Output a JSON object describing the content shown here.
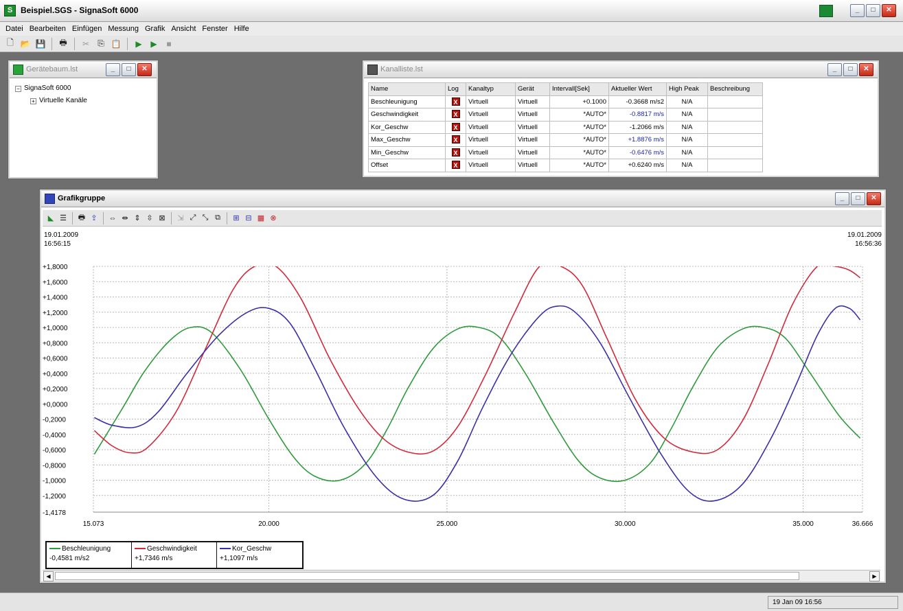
{
  "app": {
    "title": "Beispiel.SGS - SignaSoft 6000"
  },
  "menu": [
    "Datei",
    "Bearbeiten",
    "Einfügen",
    "Messung",
    "Grafik",
    "Ansicht",
    "Fenster",
    "Hilfe"
  ],
  "toolbar": {
    "icons": [
      "new-file-icon",
      "open-folder-icon",
      "save-icon",
      "print-icon",
      "cut-icon",
      "copy-icon",
      "paste-icon",
      "start-icon",
      "start-all-icon",
      "stop-icon"
    ]
  },
  "tree_window": {
    "title": "Gerätebaum.lst",
    "items": [
      {
        "label": "SignaSoft 6000",
        "pm": "−"
      },
      {
        "label": "Virtuelle Kanäle",
        "pm": "+"
      }
    ]
  },
  "channel_window": {
    "title": "Kanalliste.lst",
    "columns": [
      "Name",
      "Log",
      "Kanaltyp",
      "Gerät",
      "Intervall[Sek]",
      "Aktueller Wert",
      "High Peak",
      "Beschreibung"
    ],
    "rows": [
      {
        "name": "Beschleunigung",
        "log": "X",
        "typ": "Virtuell",
        "geraet": "Virtuell",
        "intervall": "+0.1000",
        "wert": "-0.3668 m/s2",
        "high": "N/A",
        "beschr": "",
        "blue": false
      },
      {
        "name": "Geschwindigkeit",
        "log": "X",
        "typ": "Virtuell",
        "geraet": "Virtuell",
        "intervall": "*AUTO*",
        "wert": "-0.8817 m/s",
        "high": "N/A",
        "beschr": "",
        "blue": true
      },
      {
        "name": "Kor_Geschw",
        "log": "X",
        "typ": "Virtuell",
        "geraet": "Virtuell",
        "intervall": "*AUTO*",
        "wert": "-1.2066 m/s",
        "high": "N/A",
        "beschr": "",
        "blue": false
      },
      {
        "name": "Max_Geschw",
        "log": "X",
        "typ": "Virtuell",
        "geraet": "Virtuell",
        "intervall": "*AUTO*",
        "wert": "+1.8876 m/s",
        "high": "N/A",
        "beschr": "",
        "blue": true
      },
      {
        "name": "Min_Geschw",
        "log": "X",
        "typ": "Virtuell",
        "geraet": "Virtuell",
        "intervall": "*AUTO*",
        "wert": "-0.6476 m/s",
        "high": "N/A",
        "beschr": "",
        "blue": true
      },
      {
        "name": "Offset",
        "log": "X",
        "typ": "Virtuell",
        "geraet": "Virtuell",
        "intervall": "*AUTO*",
        "wert": "+0.6240 m/s",
        "high": "N/A",
        "beschr": "",
        "blue": false
      }
    ]
  },
  "graph_window": {
    "title": "Grafikgruppe",
    "start_date": "19.01.2009",
    "start_time": "16:56:15",
    "end_date": "19.01.2009",
    "end_time": "16:56:36",
    "legend": [
      {
        "name": "Beschleunigung",
        "value": "-0,4581 m/s2",
        "color": "#2e9a3c"
      },
      {
        "name": "Geschwindigkeit",
        "value": "+1,7346 m/s",
        "color": "#d4283a"
      },
      {
        "name": "Kor_Geschw",
        "value": "+1,1097 m/s",
        "color": "#3a2fa8"
      }
    ]
  },
  "chart_data": {
    "type": "line",
    "ylim": [
      -1.4178,
      1.8
    ],
    "xlim": [
      15.073,
      36.666
    ],
    "y_ticks": [
      "+1,8000",
      "+1,6000",
      "+1,4000",
      "+1,2000",
      "+1,0000",
      "+0,8000",
      "+0,6000",
      "+0,4000",
      "+0,2000",
      "+0,0000",
      "-0,2000",
      "-0,4000",
      "-0,6000",
      "-0,8000",
      "-1,0000",
      "-1,2000",
      "-1,4178"
    ],
    "y_tick_values": [
      1.8,
      1.6,
      1.4,
      1.2,
      1.0,
      0.8,
      0.6,
      0.4,
      0.2,
      0.0,
      -0.2,
      -0.4,
      -0.6,
      -0.8,
      -1.0,
      -1.2,
      -1.4178
    ],
    "x_ticks": [
      "15.073",
      "20.000",
      "25.000",
      "30.000",
      "35.000",
      "36.666"
    ],
    "x_tick_values": [
      15.073,
      20.0,
      25.0,
      30.0,
      35.0,
      36.666
    ],
    "grid": true,
    "series": [
      {
        "name": "Beschleunigung",
        "color": "#2e9a3c",
        "x": [
          15.1,
          15.9,
          16.5,
          17.2,
          17.8,
          18.4,
          19.2,
          20.0,
          20.7,
          21.3,
          22.0,
          22.7,
          23.3,
          23.9,
          24.6,
          25.3,
          25.9,
          26.5,
          27.2,
          28.0,
          28.7,
          29.3,
          30.0,
          30.7,
          31.3,
          31.9,
          32.6,
          33.3,
          33.9,
          34.5,
          35.2,
          36.0,
          36.6
        ],
        "y": [
          -0.66,
          -0.05,
          0.42,
          0.82,
          1.0,
          0.93,
          0.45,
          -0.2,
          -0.7,
          -0.95,
          -1.0,
          -0.79,
          -0.35,
          0.2,
          0.72,
          0.98,
          1.0,
          0.86,
          0.4,
          -0.25,
          -0.75,
          -0.97,
          -1.0,
          -0.78,
          -0.32,
          0.22,
          0.74,
          0.98,
          1.0,
          0.86,
          0.4,
          -0.15,
          -0.45
        ]
      },
      {
        "name": "Geschwindigkeit",
        "color": "#d4283a",
        "x": [
          15.1,
          15.6,
          16.1,
          16.6,
          17.4,
          18.2,
          19.0,
          19.6,
          20.2,
          20.9,
          21.7,
          22.5,
          23.2,
          23.9,
          24.6,
          25.3,
          26.1,
          26.9,
          27.6,
          28.2,
          28.8,
          29.5,
          30.3,
          31.1,
          31.9,
          32.6,
          33.3,
          34.0,
          34.7,
          35.4,
          35.9,
          36.3,
          36.6
        ],
        "y": [
          -0.35,
          -0.55,
          -0.64,
          -0.57,
          -0.1,
          0.7,
          1.5,
          1.8,
          1.8,
          1.38,
          0.6,
          -0.05,
          -0.45,
          -0.63,
          -0.62,
          -0.3,
          0.4,
          1.2,
          1.8,
          1.8,
          1.55,
          0.85,
          0.05,
          -0.45,
          -0.63,
          -0.6,
          -0.22,
          0.5,
          1.3,
          1.8,
          1.8,
          1.75,
          1.65
        ]
      },
      {
        "name": "Kor_Geschw",
        "color": "#3a2fa8",
        "x": [
          15.1,
          15.6,
          16.3,
          16.9,
          17.7,
          18.6,
          19.4,
          20.0,
          20.6,
          21.3,
          22.1,
          23.0,
          23.8,
          24.6,
          25.3,
          26.0,
          26.8,
          27.6,
          28.1,
          28.6,
          29.3,
          30.1,
          31.0,
          31.8,
          32.5,
          33.3,
          34.1,
          34.8,
          35.4,
          35.9,
          36.3,
          36.6
        ],
        "y": [
          -0.18,
          -0.28,
          -0.3,
          -0.1,
          0.4,
          0.9,
          1.2,
          1.25,
          1.05,
          0.45,
          -0.3,
          -0.95,
          -1.25,
          -1.2,
          -0.75,
          -0.05,
          0.65,
          1.15,
          1.28,
          1.2,
          0.8,
          0.1,
          -0.65,
          -1.15,
          -1.27,
          -1.05,
          -0.45,
          0.25,
          0.9,
          1.25,
          1.25,
          1.1
        ]
      }
    ]
  },
  "status": {
    "clock": "19 Jan 09 16:56"
  }
}
